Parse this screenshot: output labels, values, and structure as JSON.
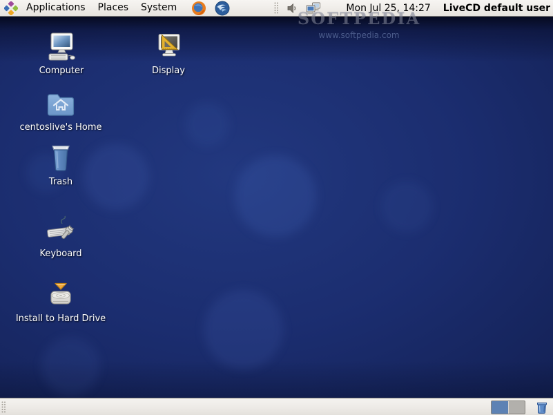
{
  "top_panel": {
    "menus": [
      {
        "label": "Applications"
      },
      {
        "label": "Places"
      },
      {
        "label": "System"
      }
    ],
    "launchers": [
      {
        "name": "firefox"
      },
      {
        "name": "thunderbird"
      }
    ],
    "clock": "Mon Jul 25, 14:27",
    "user_label": "LiveCD default user"
  },
  "desktop": {
    "icons": [
      {
        "label": "Computer"
      },
      {
        "label": "Display"
      },
      {
        "label": "centoslive's Home"
      },
      {
        "label": "Trash"
      },
      {
        "label": "Keyboard"
      },
      {
        "label": "Install to Hard Drive"
      }
    ],
    "watermark": {
      "title": "SOFTPEDIA",
      "url": "www.softpedia.com"
    }
  },
  "bottom_panel": {
    "workspaces": {
      "count": 2,
      "active": 1
    }
  },
  "colors": {
    "wallpaper_mid": "#1d3178",
    "wallpaper_dark": "#0d1840",
    "panel_bg": "#efece8",
    "workspace_active": "#5d82b4",
    "workspace_inactive": "#b2b0ac",
    "arrow_orange": "#f0a43c"
  }
}
